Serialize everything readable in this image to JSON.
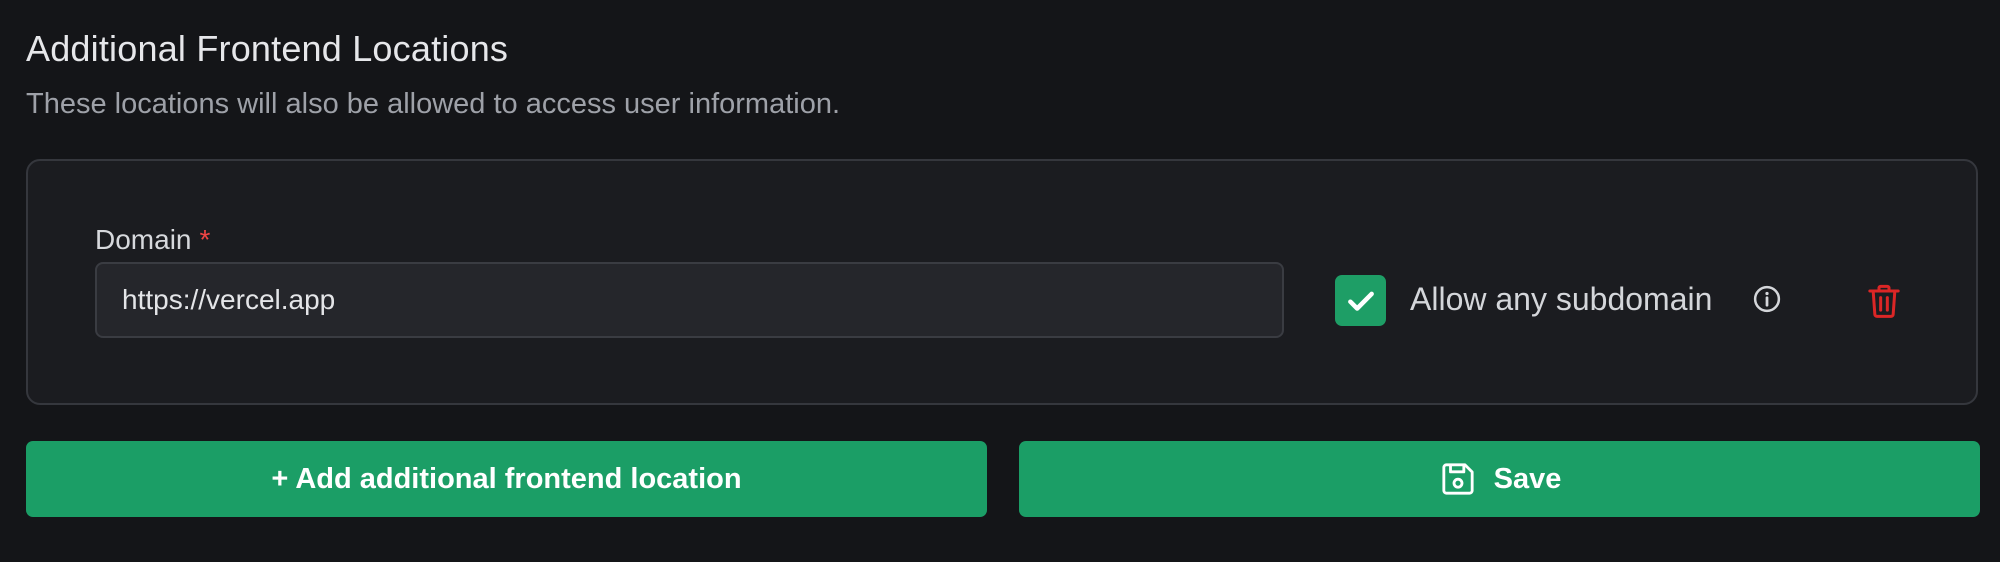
{
  "section": {
    "title": "Additional Frontend Locations",
    "subtitle": "These locations will also be allowed to access user information."
  },
  "location_row": {
    "domain_label": "Domain",
    "required_marker": "*",
    "domain_value": "https://vercel.app",
    "allow_subdomain_checked": true,
    "allow_subdomain_label": "Allow any subdomain"
  },
  "buttons": {
    "add_label": "+ Add additional frontend location",
    "save_label": "Save"
  },
  "icons": {
    "checkbox": "check-icon",
    "info": "info-icon",
    "delete": "trash-icon",
    "save": "floppy-disk-icon"
  },
  "colors": {
    "background": "#141518",
    "accent_green": "#1b9e66",
    "danger_red": "#dc2626",
    "required_red": "#ef4444"
  }
}
